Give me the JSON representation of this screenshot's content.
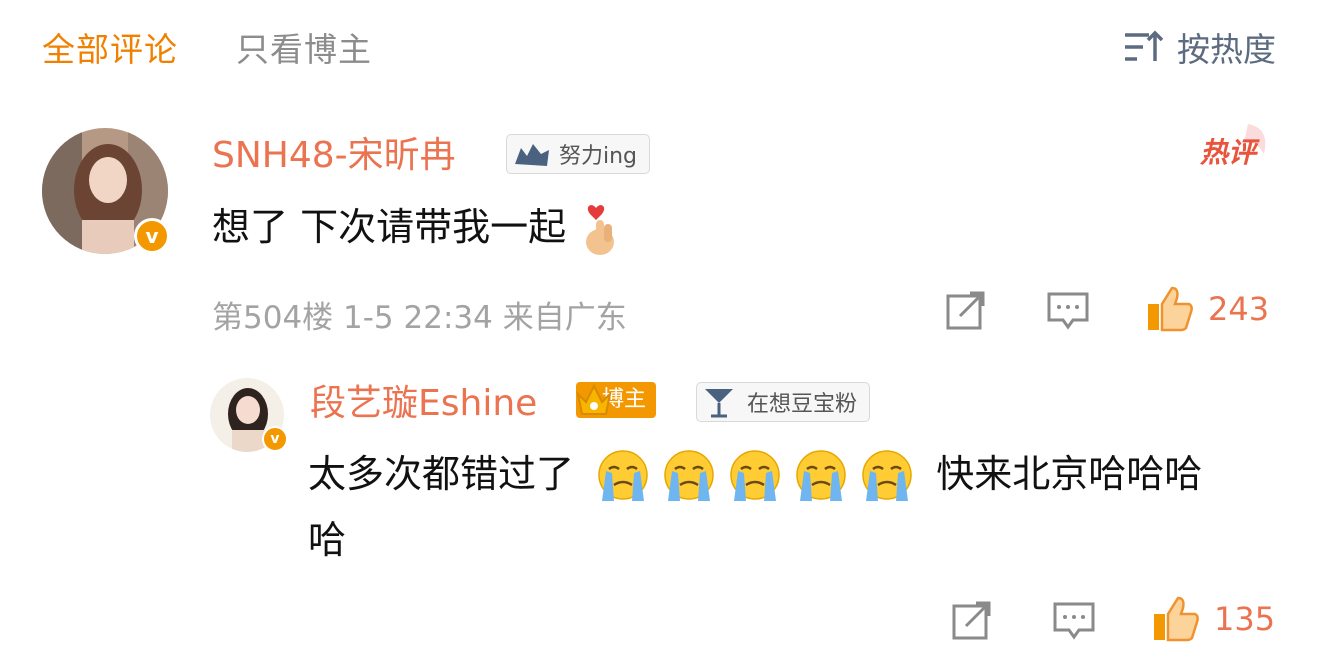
{
  "tabs": {
    "all": "全部评论",
    "owner_only": "只看博主"
  },
  "sort": {
    "label": "按热度",
    "icon": "sort-icon"
  },
  "hot_tag": "热评",
  "colors": {
    "accent": "#f08000",
    "username": "#eb7350",
    "muted": "#a3a3a3",
    "verified": "#f39800"
  },
  "comment": {
    "username": "SNH48-宋昕冉",
    "badge": "努力ing",
    "text": "想了 下次请带我一起",
    "emoji": "finger-heart-emoji",
    "meta": "第504楼 1-5 22:34 来自广东",
    "likes": "243"
  },
  "reply": {
    "username": "段艺璇Eshine",
    "owner_badge": "博主",
    "fan_badge": "在想豆宝粉",
    "text_line1_a": "太多次都错过了",
    "text_line1_b": "快来北京哈哈哈",
    "text_line2": "哈",
    "emoji": "crying-face-emoji",
    "likes": "135"
  }
}
